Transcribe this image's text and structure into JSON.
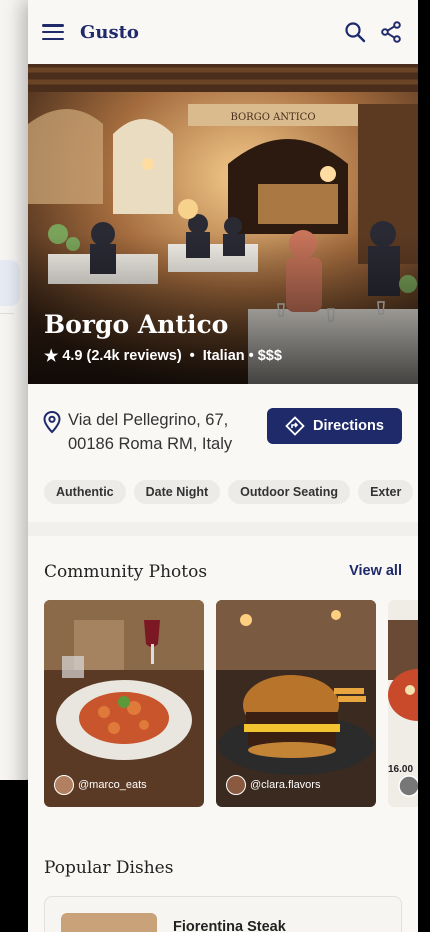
{
  "app": {
    "brand": "Gusto"
  },
  "restaurant": {
    "name": "Borgo Antico",
    "rating": "4.9 (2.4k reviews)",
    "cuisine": "Italian",
    "price": "$$$",
    "sign": "BORGO ANTICO",
    "address_line1": "Via del Pellegrino, 67,",
    "address_line2": "00186 Roma RM, Italy",
    "directions_label": "Directions"
  },
  "tags": [
    "Authentic",
    "Date Night",
    "Outdoor Seating",
    "Exter"
  ],
  "community": {
    "title": "Community Photos",
    "view_all": "View all",
    "photos": [
      {
        "user": "@marco_eats"
      },
      {
        "user": "@clara.flavors"
      },
      {
        "price": "16.00"
      }
    ]
  },
  "popular": {
    "title": "Popular Dishes",
    "first_dish": "Fiorentina Steak"
  },
  "colors": {
    "accent": "#1f2a6b",
    "background": "#faf8f5"
  },
  "icons": [
    "menu-icon",
    "search-icon",
    "share-icon",
    "star-icon",
    "location-pin-icon",
    "directions-icon"
  ]
}
